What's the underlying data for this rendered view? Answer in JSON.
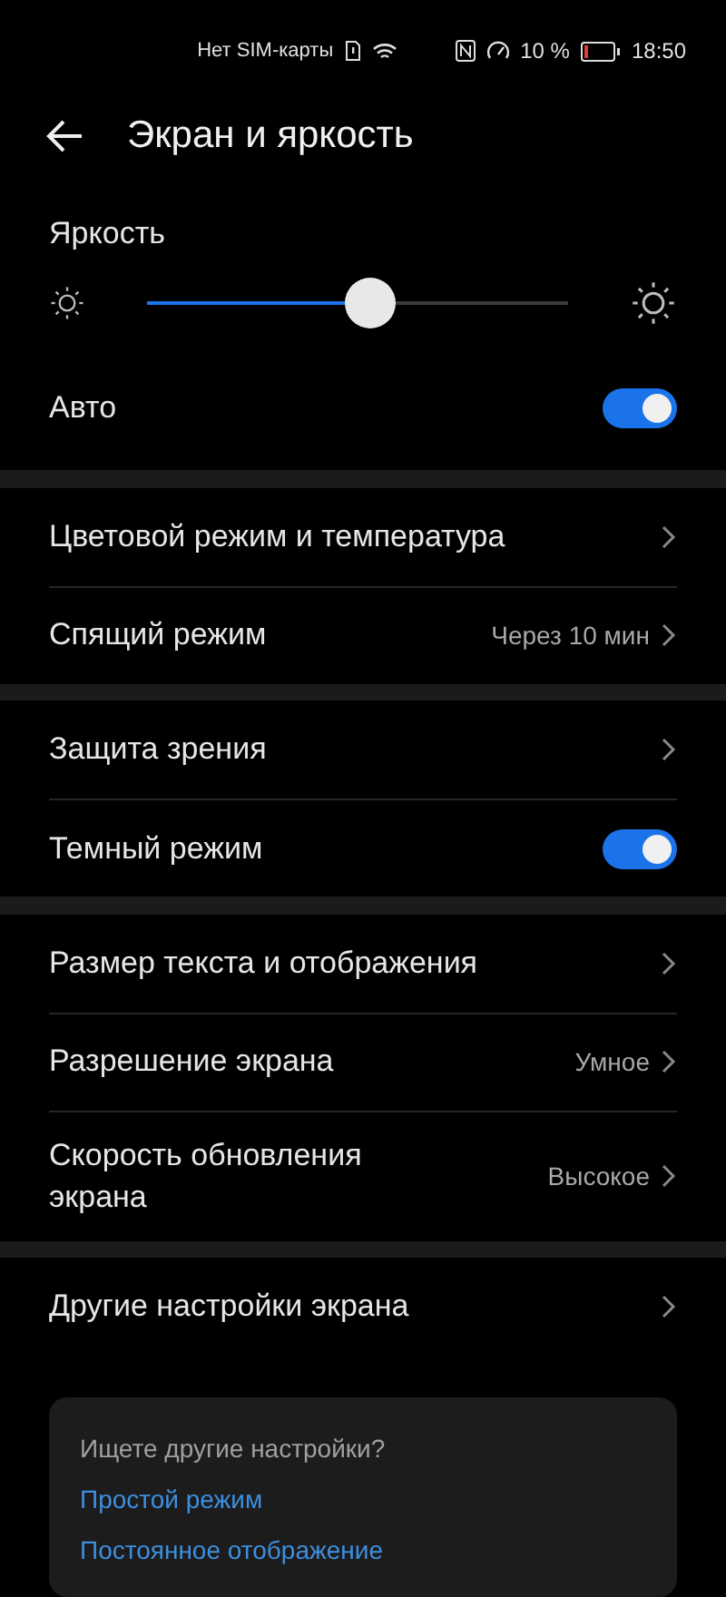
{
  "status_bar": {
    "sim": "Нет SIM-карты",
    "battery": "10 %",
    "time": "18:50"
  },
  "header": {
    "title": "Экран и яркость"
  },
  "brightness": {
    "label": "Яркость",
    "level": 0.53,
    "auto": {
      "label": "Авто",
      "on": true
    }
  },
  "groups": [
    {
      "rows": [
        {
          "kind": "link",
          "label": "Цветовой режим и температура"
        },
        {
          "kind": "link",
          "label": "Спящий режим",
          "value": "Через 10 мин"
        }
      ]
    },
    {
      "rows": [
        {
          "kind": "link",
          "label": "Защита зрения"
        },
        {
          "kind": "toggle",
          "label": "Темный режим",
          "on": true
        }
      ]
    },
    {
      "rows": [
        {
          "kind": "link",
          "label": "Размер текста и отображения"
        },
        {
          "kind": "link",
          "label": "Разрешение экрана",
          "value": "Умное"
        },
        {
          "kind": "link",
          "label": "Скорость обновления экрана",
          "value": "Высокое"
        }
      ]
    },
    {
      "rows": [
        {
          "kind": "link",
          "label": "Другие настройки экрана"
        }
      ]
    }
  ],
  "suggestions": {
    "title": "Ищете другие настройки?",
    "links": [
      "Простой режим",
      "Постоянное отображение"
    ]
  }
}
